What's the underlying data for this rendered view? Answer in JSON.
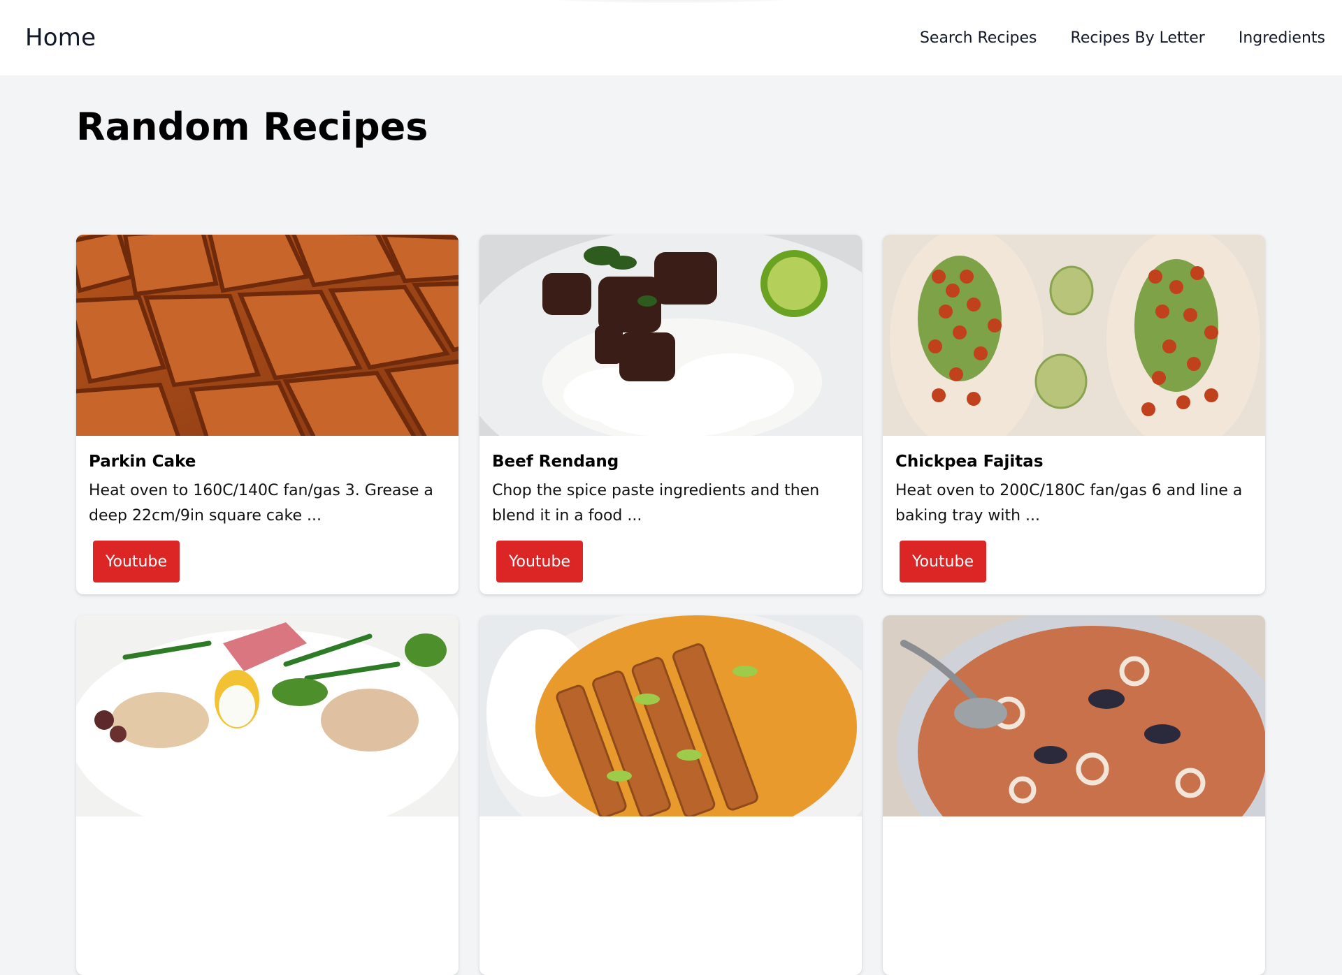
{
  "header": {
    "home_label": "Home",
    "nav": [
      {
        "label": "Search Recipes"
      },
      {
        "label": "Recipes By Letter"
      },
      {
        "label": "Ingredients"
      }
    ]
  },
  "main": {
    "title": "Random Recipes",
    "recipes": [
      {
        "name": "Parkin Cake",
        "description": "Heat oven to 160C/140C fan/gas 3. Grease a deep 22cm/9in square cake ...",
        "button_label": "Youtube",
        "image": "parkin-cake-photo"
      },
      {
        "name": "Beef Rendang",
        "description": "Chop the spice paste ingredients and then blend it in a food ...",
        "button_label": "Youtube",
        "image": "beef-rendang-photo"
      },
      {
        "name": "Chickpea Fajitas",
        "description": "Heat oven to 200C/180C fan/gas 6 and line a baking tray with ...",
        "button_label": "Youtube",
        "image": "chickpea-fajitas-photo"
      },
      {
        "image": "nicoise-salad-photo"
      },
      {
        "image": "katsu-curry-photo"
      },
      {
        "image": "seafood-soup-photo"
      }
    ]
  },
  "colors": {
    "button_bg": "#dc2626",
    "page_bg": "#f3f4f6",
    "header_bg": "#ffffff"
  }
}
